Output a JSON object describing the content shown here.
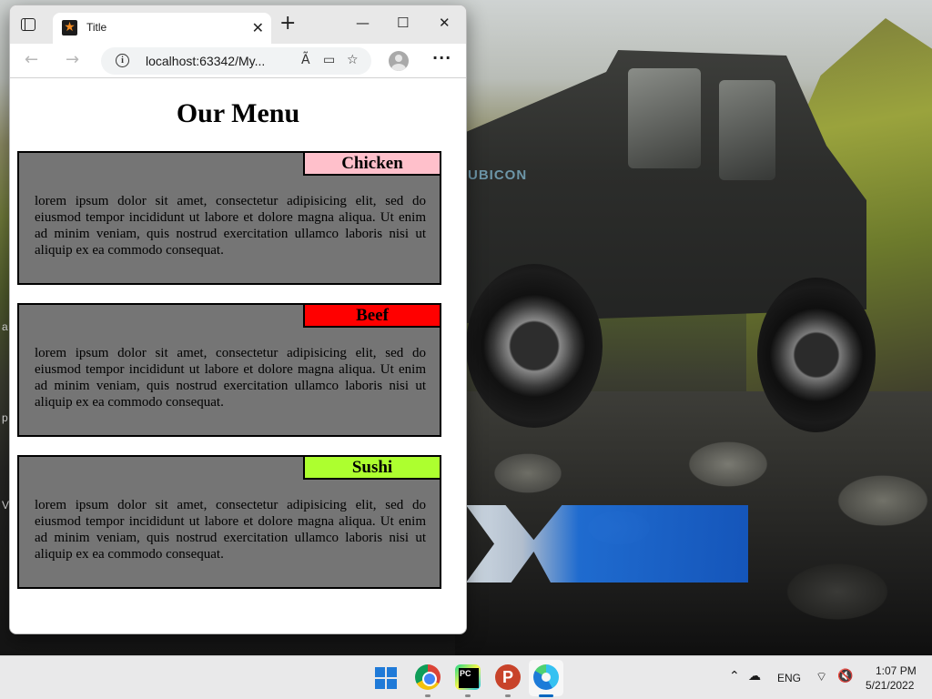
{
  "desktop": {
    "edge_fragments": [
      "a",
      "p",
      "V"
    ]
  },
  "browser": {
    "tab": {
      "title": "Title",
      "favicon": "star-icon"
    },
    "address": {
      "url": "localhost:63342/My..."
    },
    "window_controls": {
      "minimize": "—",
      "maximize": "☐",
      "close": "✕"
    }
  },
  "page": {
    "heading": "Our Menu",
    "cards": [
      {
        "label": "Chicken",
        "label_color": "#ffc0cb",
        "text": "lorem ipsum dolor sit amet, consectetur adipisicing elit, sed do eiusmod tempor incididunt ut labore et dolore magna aliqua. Ut enim ad minim veniam, quis nostrud exercitation ullamco laboris nisi ut aliquip ex ea commodo consequat."
      },
      {
        "label": "Beef",
        "label_color": "#ff0000",
        "text": "lorem ipsum dolor sit amet, consectetur adipisicing elit, sed do eiusmod tempor incididunt ut labore et dolore magna aliqua. Ut enim ad minim veniam, quis nostrud exercitation ullamco laboris nisi ut aliquip ex ea commodo consequat."
      },
      {
        "label": "Sushi",
        "label_color": "#adff2f",
        "text": "lorem ipsum dolor sit amet, consectetur adipisicing elit, sed do eiusmod tempor incididunt ut labore et dolore magna aliqua. Ut enim ad minim veniam, quis nostrud exercitation ullamco laboris nisi ut aliquip ex ea commodo consequat."
      }
    ],
    "card_bg_color": "#757575"
  },
  "taskbar": {
    "apps": [
      "windows-start-icon",
      "chrome-icon",
      "pycharm-icon",
      "p-app-icon",
      "edge-icon"
    ],
    "tray": {
      "language": "ENG",
      "time": "1:07 PM",
      "date": "5/21/2022"
    }
  }
}
